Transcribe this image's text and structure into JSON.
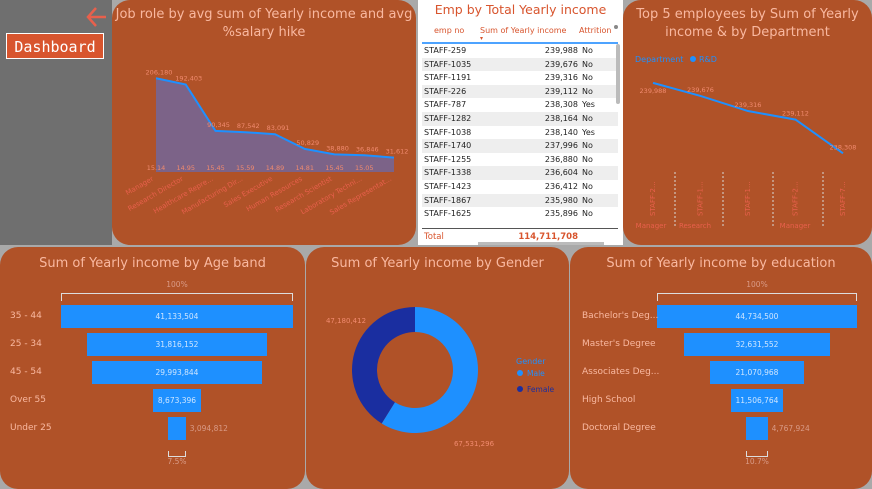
{
  "nav": {
    "dashboard_label": "Dashboard"
  },
  "cards": {
    "job_role_title_line1": "Job role by avg sum of Yearly income and avg",
    "job_role_title_line2": "%salary hike",
    "table_title": "Emp by Total Yearly income",
    "top5_title_line1": "Top 5 employees by Sum of Yearly",
    "top5_title_line2": "income & by Department",
    "age_title": "Sum of Yearly income by Age band",
    "gender_title": "Sum of Yearly income by Gender",
    "edu_title": "Sum of Yearly income by education"
  },
  "table": {
    "headers": [
      "emp no",
      "Sum of Yearly income",
      "Attrition"
    ],
    "rows": [
      [
        "STAFF-259",
        "239,988",
        "No"
      ],
      [
        "STAFF-1035",
        "239,676",
        "No"
      ],
      [
        "STAFF-1191",
        "239,316",
        "No"
      ],
      [
        "STAFF-226",
        "239,112",
        "No"
      ],
      [
        "STAFF-787",
        "238,308",
        "Yes"
      ],
      [
        "STAFF-1282",
        "238,164",
        "No"
      ],
      [
        "STAFF-1038",
        "238,140",
        "Yes"
      ],
      [
        "STAFF-1740",
        "237,996",
        "No"
      ],
      [
        "STAFF-1255",
        "236,880",
        "No"
      ],
      [
        "STAFF-1338",
        "236,604",
        "No"
      ],
      [
        "STAFF-1423",
        "236,412",
        "No"
      ],
      [
        "STAFF-1867",
        "235,980",
        "No"
      ],
      [
        "STAFF-1625",
        "235,896",
        "No"
      ]
    ],
    "total_label": "Total",
    "total_value": "114,711,708"
  },
  "colors": {
    "accent": "#1e90ff",
    "card": "#b05228",
    "title": "#f9b8a0",
    "female": "#1a2ea0"
  },
  "chart_data": [
    {
      "type": "area",
      "categories": [
        "Manager",
        "Research Director",
        "Healthcare Repre...",
        "Manufacturing Dir...",
        "Sales Executive",
        "Human Resources",
        "Research Scientist",
        "Laboratory Techni...",
        "Sales Representat..."
      ],
      "series": [
        {
          "values": [
            206180,
            192403,
            90345,
            87542,
            83091,
            50829,
            38880,
            36846,
            31612
          ],
          "labels": [
            "206,180",
            "192,403",
            "90,345",
            "87,542",
            "83,091",
            "50,829",
            "38,880",
            "36,846",
            "31,612"
          ]
        },
        {
          "values": [
            15.14,
            14.95,
            15.45,
            15.59,
            14.89,
            14.81,
            15.45,
            15.05
          ],
          "labels": [
            "15.14",
            "14.95",
            "15.45",
            "15.59",
            "14.89",
            "14.81",
            "15.45",
            "15.05"
          ]
        }
      ],
      "ylim": [
        0,
        220000
      ]
    },
    {
      "type": "line",
      "legend_title": "Department",
      "legend": [
        "R&D"
      ],
      "categories": [
        "STAFF-2...",
        "STAFF-1...",
        "STAFF-1...",
        "STAFF-2...",
        "STAFF-7..."
      ],
      "groups": [
        "Manager",
        "Research",
        "Manager"
      ],
      "values": [
        239988,
        239676,
        239316,
        239112,
        238308
      ],
      "labels": [
        "239,988",
        "239,676",
        "239,316",
        "239,112",
        "238,308"
      ],
      "ylim": [
        238100,
        240200
      ]
    },
    {
      "type": "bar",
      "orientation": "funnel",
      "scale_label": "100%",
      "bottom_label": "7.5%",
      "categories": [
        "35 - 44",
        "25 - 34",
        "45 - 54",
        "Over 55",
        "Under 25"
      ],
      "values": [
        41133504,
        31816152,
        29993844,
        8673396,
        3094812
      ],
      "labels": [
        "41,133,504",
        "31,816,152",
        "29,993,844",
        "8,673,396",
        "3,094,812"
      ]
    },
    {
      "type": "pie",
      "legend_title": "Gender",
      "categories": [
        "Male",
        "Female"
      ],
      "values": [
        67531296,
        47180412
      ],
      "labels": [
        "67,531,296",
        "47,180,412"
      ]
    },
    {
      "type": "bar",
      "orientation": "funnel",
      "scale_label": "100%",
      "bottom_label": "10.7%",
      "categories": [
        "Bachelor's Deg...",
        "Master's Degree",
        "Associates Deg...",
        "High School",
        "Doctoral Degree"
      ],
      "values": [
        44734500,
        32631552,
        21070968,
        11506764,
        4767924
      ],
      "labels": [
        "44,734,500",
        "32,631,552",
        "21,070,968",
        "11,506,764",
        "4,767,924"
      ]
    }
  ]
}
